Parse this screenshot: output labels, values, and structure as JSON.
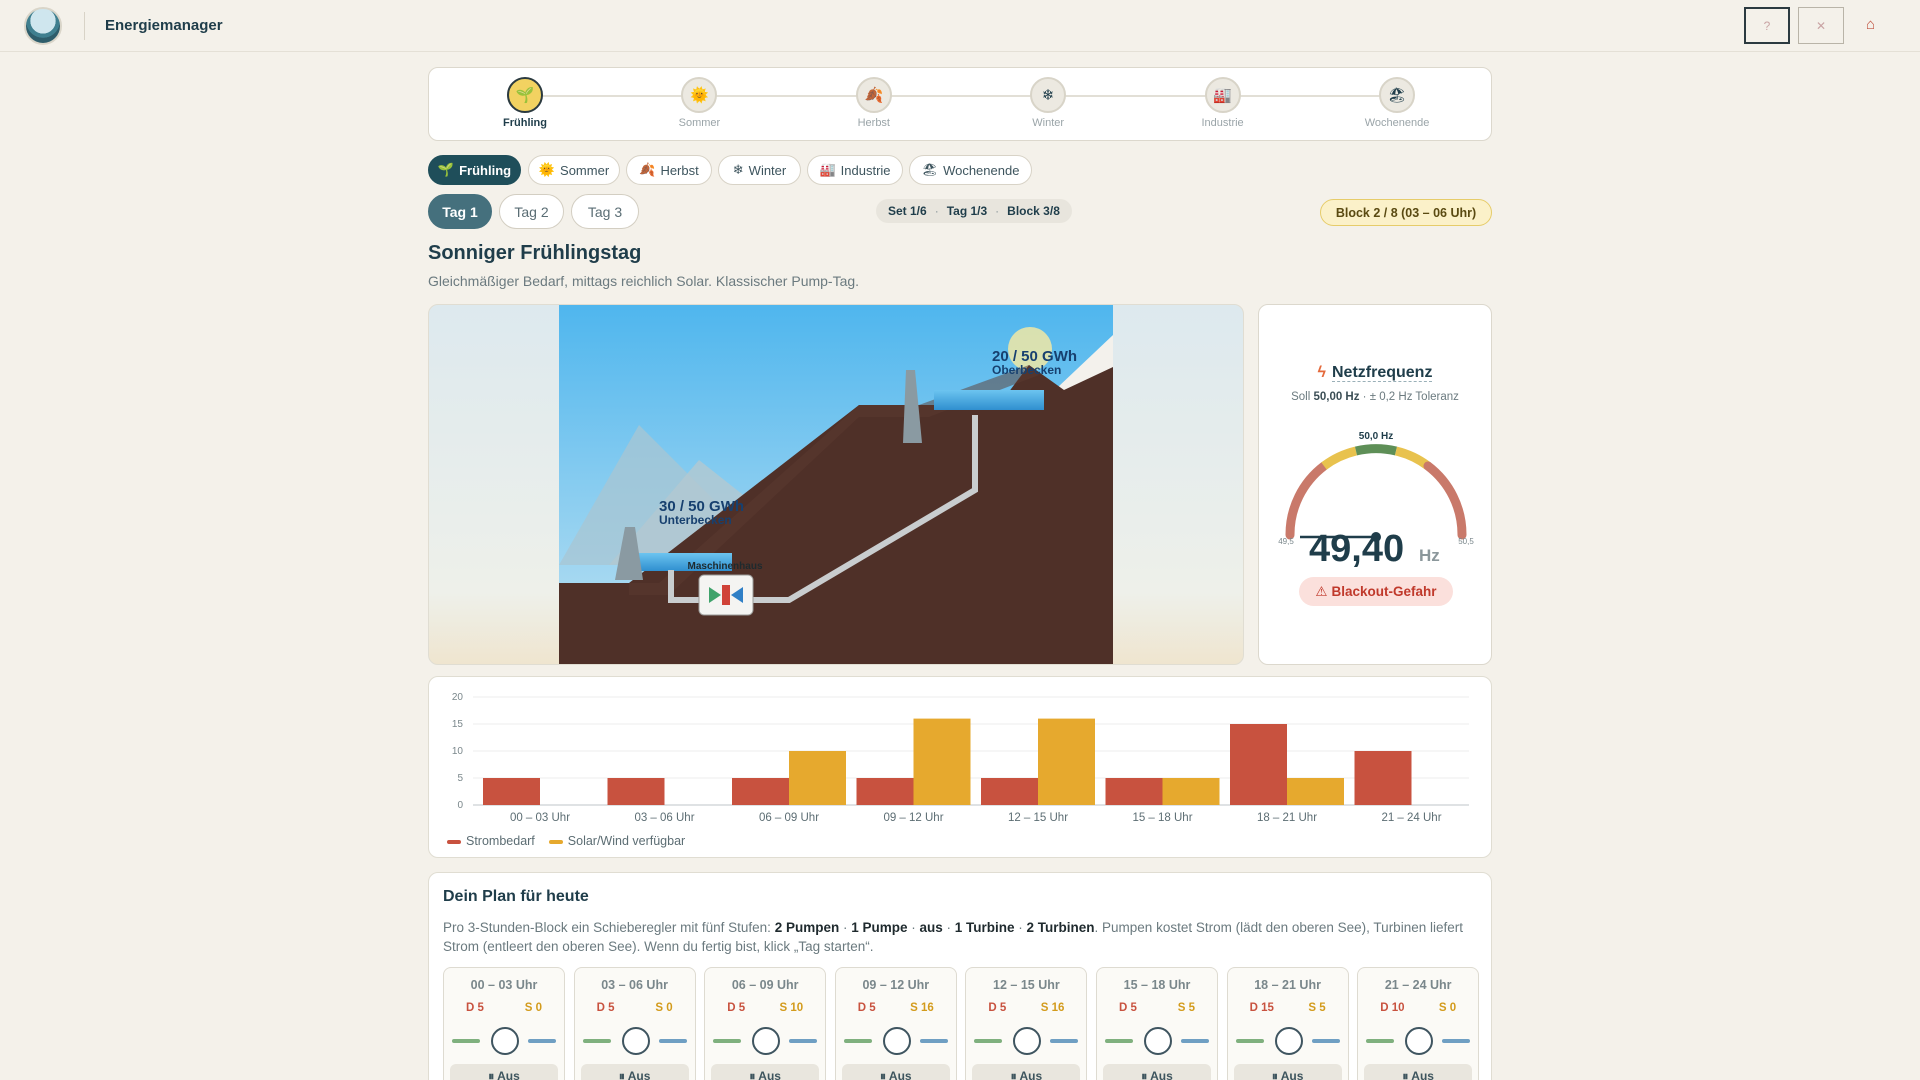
{
  "app": {
    "title": "Energiemanager",
    "header_buttons": [
      "?",
      "✕"
    ],
    "home_icon": "home-icon"
  },
  "stepper": [
    {
      "label": "Frühling",
      "icon": "🌱",
      "active": true
    },
    {
      "label": "Sommer",
      "icon": "🌞",
      "active": false
    },
    {
      "label": "Herbst",
      "icon": "🍂",
      "active": false
    },
    {
      "label": "Winter",
      "icon": "❄",
      "active": false
    },
    {
      "label": "Industrie",
      "icon": "🏭",
      "active": false
    },
    {
      "label": "Wochenende",
      "icon": "🏖",
      "active": false
    }
  ],
  "scenario_pills": [
    {
      "label": "Frühling",
      "icon": "🌱"
    },
    {
      "label": "Sommer",
      "icon": "🌞"
    },
    {
      "label": "Herbst",
      "icon": "🍂"
    },
    {
      "label": "Winter",
      "icon": "❄"
    },
    {
      "label": "Industrie",
      "icon": "🏭"
    },
    {
      "label": "Wochenende",
      "icon": "🏖"
    }
  ],
  "days": [
    "Tag 1",
    "Tag 2",
    "Tag 3"
  ],
  "progress": {
    "set": "Set 1/6",
    "day": "Tag 1/3",
    "block": "Block 3/8"
  },
  "block_badge": "Block 2 / 8 (03 – 06 Uhr)",
  "day": {
    "title": "Sonniger Frühlingstag",
    "subtitle": "Gleichmäßiger Bedarf, mittags reichlich Solar. Klassischer Pump-Tag."
  },
  "scene": {
    "upper_value": "20 / 50 GWh",
    "upper_label": "Oberbecken",
    "lower_value": "30 / 50 GWh",
    "lower_label": "Unterbecken",
    "powerhouse_label": "Maschinenhaus"
  },
  "frequency": {
    "title": "Netzfrequenz",
    "target_prefix": "Soll ",
    "target": "50,00 Hz",
    "tolerance": " · ± 0,2 Hz Toleranz",
    "value": "49,40",
    "unit": "Hz",
    "scale_min": "49,5",
    "scale_mid": "50,0 Hz",
    "scale_max": "50,5",
    "alert": "Blackout-Gefahr",
    "needle_value": 49.4
  },
  "chart_data": {
    "type": "bar",
    "categories": [
      "00 – 03 Uhr",
      "03 – 06 Uhr",
      "06 – 09 Uhr",
      "09 – 12 Uhr",
      "12 – 15 Uhr",
      "15 – 18 Uhr",
      "18 – 21 Uhr",
      "21 – 24 Uhr"
    ],
    "series": [
      {
        "name": "Strombedarf",
        "color": "#c8523f",
        "values": [
          5,
          5,
          5,
          5,
          5,
          5,
          15,
          10
        ]
      },
      {
        "name": "Solar/Wind verfügbar",
        "color": "#e6a92e",
        "values": [
          0,
          0,
          10,
          16,
          16,
          5,
          5,
          0
        ]
      }
    ],
    "yticks": [
      0,
      5,
      10,
      15,
      20
    ],
    "ylim": [
      0,
      20
    ],
    "grid": true,
    "legend": "bottom-left"
  },
  "plan": {
    "title": "Dein Plan für heute",
    "text_a": "Pro 3-Stunden-Block ein Schieberegler mit fünf Stufen: ",
    "opt1": "2 Pumpen",
    "opt2": "1 Pumpe",
    "opt3": "aus",
    "opt4": "1 Turbine",
    "opt5": "2 Turbinen",
    "text_b": ". Pumpen kostet Strom (lädt den oberen See), Turbinen liefert Strom (entleert den oberen See). Wenn du fertig bist, klick „Tag starten“.",
    "blocks": [
      {
        "time": "00 – 03 Uhr",
        "d": "D 5",
        "s": "S 0",
        "mode": "⏸ Aus"
      },
      {
        "time": "03 – 06 Uhr",
        "d": "D 5",
        "s": "S 0",
        "mode": "⏸ Aus"
      },
      {
        "time": "06 – 09 Uhr",
        "d": "D 5",
        "s": "S 10",
        "mode": "⏸ Aus"
      },
      {
        "time": "09 – 12 Uhr",
        "d": "D 5",
        "s": "S 16",
        "mode": "⏸ Aus"
      },
      {
        "time": "12 – 15 Uhr",
        "d": "D 5",
        "s": "S 16",
        "mode": "⏸ Aus"
      },
      {
        "time": "15 – 18 Uhr",
        "d": "D 5",
        "s": "S 5",
        "mode": "⏸ Aus"
      },
      {
        "time": "18 – 21 Uhr",
        "d": "D 15",
        "s": "S 5",
        "mode": "⏸ Aus"
      },
      {
        "time": "21 – 24 Uhr",
        "d": "D 10",
        "s": "S 0",
        "mode": "⏸ Aus"
      }
    ]
  }
}
